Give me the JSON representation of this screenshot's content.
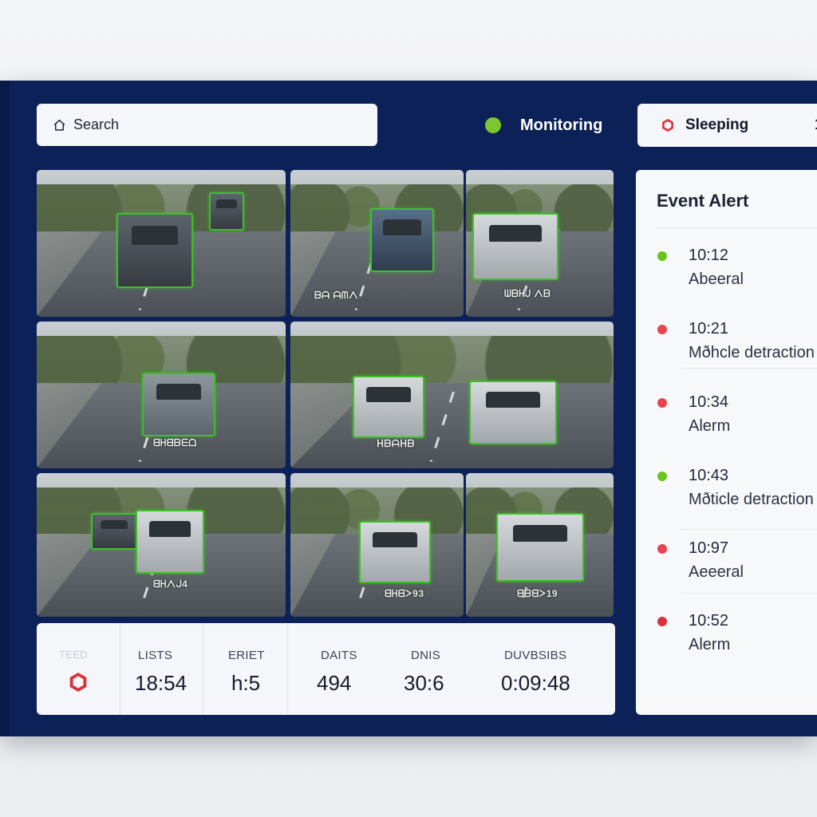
{
  "search": {
    "label": "Search",
    "icon": "home-icon"
  },
  "status": {
    "label": "Monitoring",
    "color": "#7cc62e"
  },
  "mode": {
    "label": "Sleeping",
    "icon": "hexagon-alert-icon",
    "color": "#d8323c",
    "extra": "1"
  },
  "cameras": [
    {
      "label": ""
    },
    {
      "label": "ᗷᗩ ᗩᗰᐱ"
    },
    {
      "label": "ᗯᗷᕼᒍ ᐱᗷ"
    },
    {
      "label": "ᗺᕼᗺᗷᗴᗝ"
    },
    {
      "label": "ᕼᗷᗩᕼᗷ"
    },
    {
      "label": ""
    },
    {
      "label": ""
    },
    {
      "label": "ᗺᕼᐱᒍ4"
    },
    {
      "label": "ᗺᕼᗺᐳ93"
    },
    {
      "label": "ᗺᗷᗺᐳ19"
    }
  ],
  "stats": {
    "first_label": "TEED",
    "first_icon": "hexagon-alert-icon",
    "items": [
      {
        "label": "LISTS",
        "value": "18:54"
      },
      {
        "label": "ERIET",
        "value": "h:5"
      },
      {
        "label": "DAITS",
        "value": "494"
      },
      {
        "label": "DNIS",
        "value": "30:6"
      },
      {
        "label": "DUVBSIBS",
        "value": "0:09:48"
      }
    ]
  },
  "alerts": {
    "title": "Event Alert",
    "items": [
      {
        "time": "10:12",
        "message": "Abeeral",
        "color": "#6cc41f"
      },
      {
        "time": "10:21",
        "message": "Mðhcle detraction",
        "color": "#e8434f"
      },
      {
        "time": "10:34",
        "message": "Alerm",
        "color": "#e8434f"
      },
      {
        "time": "10:43",
        "message": "Mðticle detraction",
        "color": "#6cc41f"
      },
      {
        "time": "10:97",
        "message": "Aeeeral",
        "color": "#e8434f"
      },
      {
        "time": "10:52",
        "message": "Alerm",
        "color": "#d8323c"
      }
    ]
  }
}
